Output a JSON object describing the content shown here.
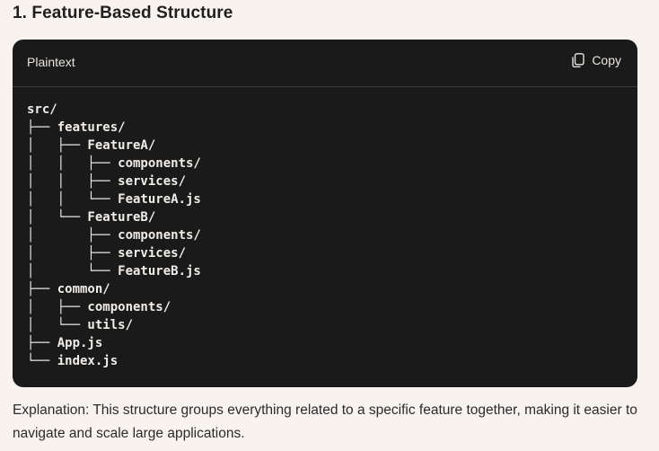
{
  "heading": "1. Feature-Based Structure",
  "code_block": {
    "language": "Plaintext",
    "copy_label": "Copy",
    "copy_icon": "copy-icon",
    "lines": [
      "src/",
      "├── features/",
      "│   ├── FeatureA/",
      "│   │   ├── components/",
      "│   │   ├── services/",
      "│   │   └── FeatureA.js",
      "│   └── FeatureB/",
      "│       ├── components/",
      "│       ├── services/",
      "│       └── FeatureB.js",
      "├── common/",
      "│   ├── components/",
      "│   └── utils/",
      "├── App.js",
      "└── index.js"
    ]
  },
  "explanation": "Explanation: This structure groups everything related to a specific feature together, making it easier to navigate and scale large applications.",
  "colors": {
    "page_background": "#f8f3ee",
    "code_background": "#1b1a1a",
    "code_text": "#f1ede8"
  }
}
